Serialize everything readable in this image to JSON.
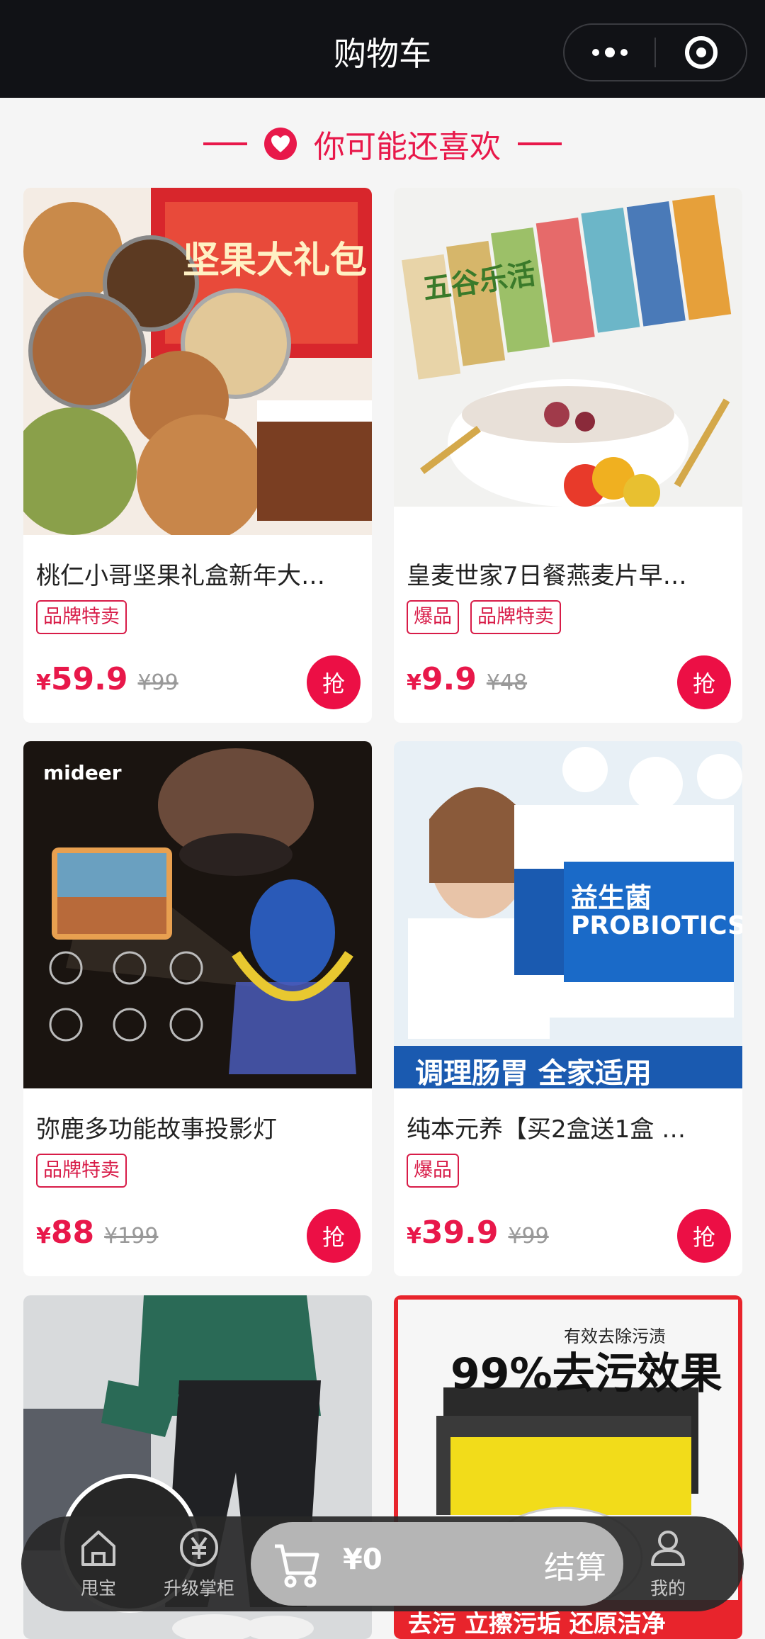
{
  "header": {
    "title": "购物车"
  },
  "section": {
    "title": "你可能还喜欢"
  },
  "products": [
    {
      "name": "桃仁小哥坚果礼盒新年大…",
      "tags": [
        "品牌特卖"
      ],
      "currency": "¥",
      "price": "59.9",
      "original": "¥99",
      "button": "抢",
      "image_text": "坚果大礼包"
    },
    {
      "name": "皇麦世家7日餐燕麦片早…",
      "tags": [
        "爆品",
        "品牌特卖"
      ],
      "currency": "¥",
      "price": "9.9",
      "original": "¥48",
      "button": "抢",
      "image_text": "五谷乐活"
    },
    {
      "name": "弥鹿多功能故事投影灯",
      "tags": [
        "品牌特卖"
      ],
      "currency": "¥",
      "price": "88",
      "original": "¥199",
      "button": "抢",
      "image_text": "mideer"
    },
    {
      "name": "纯本元养【买2盒送1盒 …",
      "tags": [
        "爆品"
      ],
      "currency": "¥",
      "price": "39.9",
      "original": "¥99",
      "button": "抢",
      "image_text": "调理肠胃 全家适用"
    },
    {
      "name": "",
      "tags": [],
      "currency": "",
      "price": "",
      "original": "",
      "button": "",
      "image_text": ""
    },
    {
      "name": "",
      "tags": [],
      "currency": "",
      "price": "",
      "original": "",
      "button": "",
      "image_text": "99%去污效果"
    }
  ],
  "image_texts": {
    "p2_brand": "益生菌",
    "p2_sub": "PROBIOTICS",
    "p5_top": "有效去除污渍",
    "p5_bottom": "去污 立擦污垢 还原洁净"
  },
  "bottom_nav": {
    "item1": "甩宝",
    "item2": "升级掌柜",
    "cart_amount": "¥0",
    "checkout": "结算",
    "item3": "我的"
  },
  "colors": {
    "accent": "#e8184a",
    "topbar": "#111216",
    "background": "#f5f5f5"
  },
  "icons": {
    "menu": "more-dots-icon",
    "close": "target-circle-icon",
    "heart": "heart-icon",
    "home": "home-icon",
    "upgrade": "yen-coin-icon",
    "cart": "cart-icon",
    "profile": "person-icon"
  }
}
